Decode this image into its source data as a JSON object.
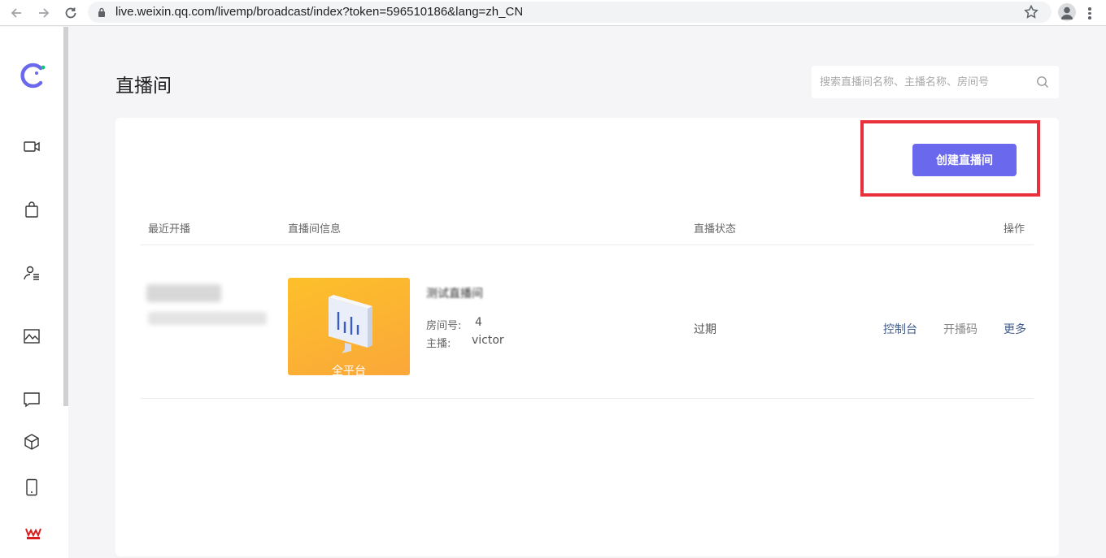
{
  "browser": {
    "url": "live.weixin.qq.com/livemp/broadcast/index?token=596510186&lang=zh_CN"
  },
  "header": {
    "title": "直播间",
    "search_placeholder": "搜索直播间名称、主播名称、房间号"
  },
  "toolbar": {
    "create_label": "创建直播间"
  },
  "table": {
    "columns": [
      "最近开播",
      "直播间信息",
      "直播状态",
      "操作"
    ],
    "rows": [
      {
        "thumb_label": "全平台",
        "room_name": "测试直播间",
        "room_no_label": "房间号:",
        "room_no": "4",
        "host_label": "主播:",
        "host": "victor",
        "status": "过期",
        "actions": [
          "控制台",
          "开播码",
          "更多"
        ]
      }
    ]
  },
  "sidebar": {
    "items": [
      "logo-icon",
      "video-icon",
      "shopping-bag-icon",
      "user-list-icon",
      "image-icon",
      "message-icon",
      "cube-icon",
      "phone-icon",
      "brand-icon"
    ]
  },
  "colors": {
    "accent": "#6a68ec",
    "highlight": "#e8313a",
    "thumb_top": "#fcc02a",
    "thumb_bottom": "#fba73a",
    "action_link": "#3f5b8a"
  }
}
